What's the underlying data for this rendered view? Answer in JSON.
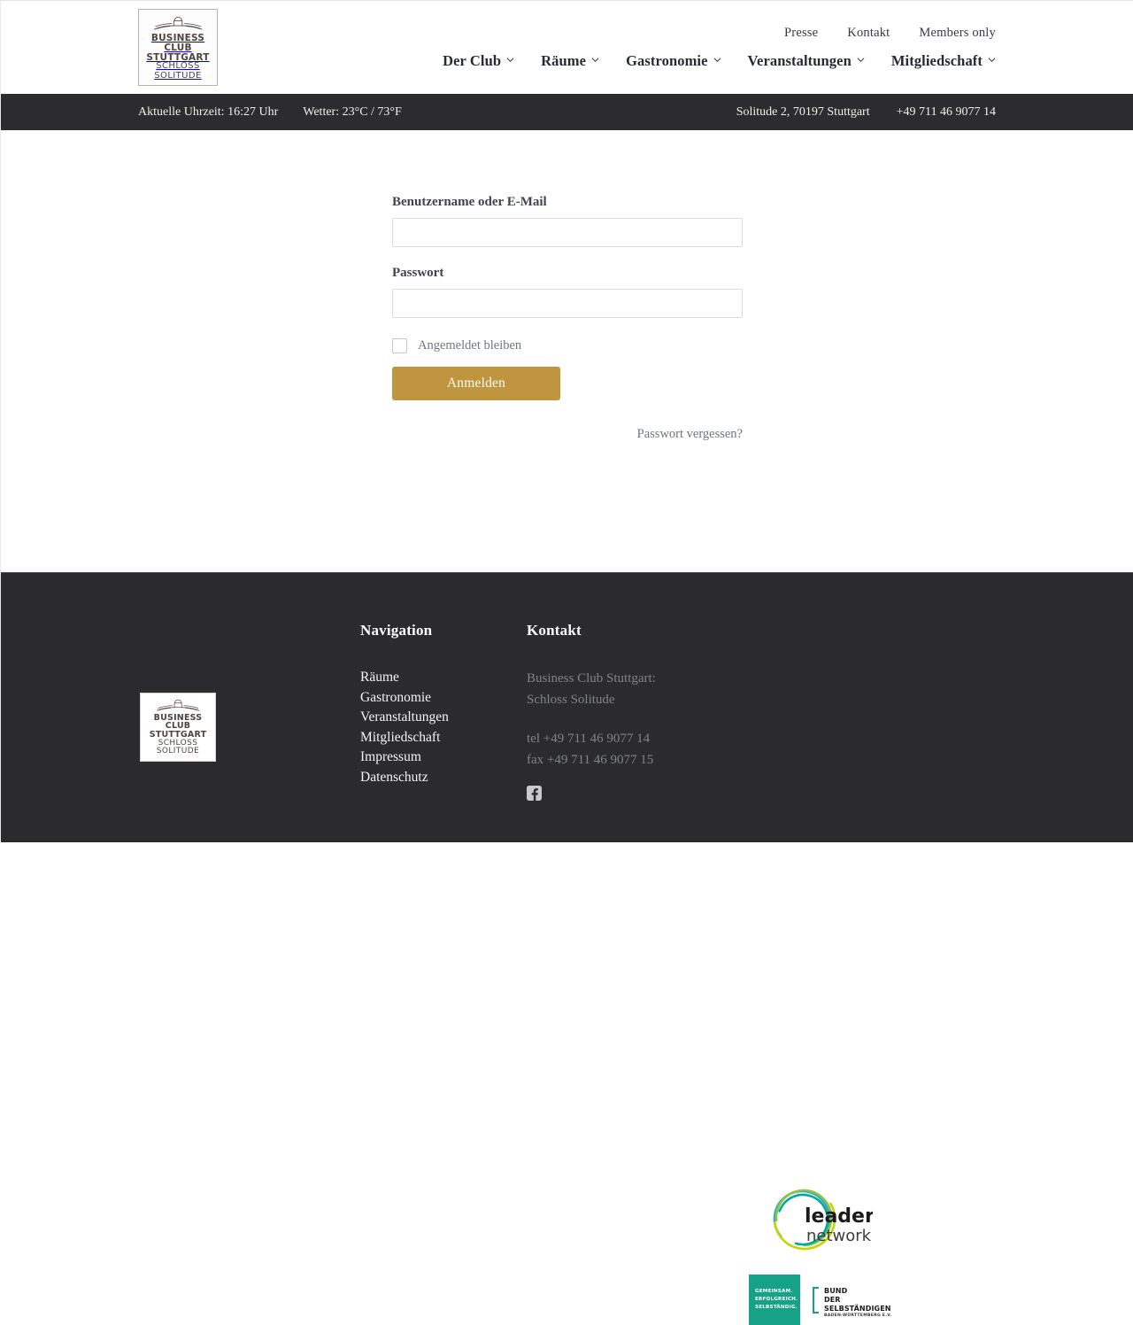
{
  "brand": {
    "logo_lines": [
      "BUSINESS",
      "CLUB",
      "STUTTGART",
      "SCHLOSS",
      "SOLITUDE"
    ],
    "emblem_icon": "palace-emblem-icon"
  },
  "header": {
    "top_links": [
      {
        "label": "Presse"
      },
      {
        "label": "Kontakt"
      },
      {
        "label": "Members only"
      }
    ],
    "nav_items": [
      {
        "label": "Der Club",
        "caret": "chevron-down-icon"
      },
      {
        "label": "Räume",
        "caret": "chevron-down-icon"
      },
      {
        "label": "Gastronomie",
        "caret": "chevron-down-icon"
      },
      {
        "label": "Veranstaltungen",
        "caret": "chevron-down-icon"
      },
      {
        "label": "Mitgliedschaft",
        "caret": "chevron-down-icon"
      }
    ]
  },
  "info_bar": {
    "time": "Aktuelle Uhrzeit: 16:27 Uhr",
    "weather": "Wetter: 23°C / 73°F",
    "address": "Solitude 2, 70197 Stuttgart",
    "phone": "+49 711 46 9077 14",
    "background": "#2c2c2e"
  },
  "login": {
    "username_label": "Benutzername oder E-Mail",
    "username_value": "",
    "username_placeholder": "",
    "password_label": "Passwort",
    "password_value": "",
    "password_placeholder": "",
    "remember_label": "Angemeldet bleiben",
    "remember_checked": false,
    "submit_label": "Anmelden",
    "submit_color": "#bf9540",
    "forgot_label": "Passwort vergessen?"
  },
  "footer": {
    "background": "#2b2b2d",
    "nav_heading": "Navigation",
    "nav_links": [
      {
        "label": "Räume"
      },
      {
        "label": "Gastronomie"
      },
      {
        "label": "Veranstaltungen"
      },
      {
        "label": "Mitgliedschaft"
      },
      {
        "label": "Impressum"
      },
      {
        "label": "Datenschutz"
      }
    ],
    "contact_heading": "Kontakt",
    "contact_name_1": "Business Club Stuttgart:",
    "contact_name_2": "Schloss Solitude",
    "contact_tel": "tel +49 711 46 9077 14",
    "contact_fax": "fax +49 711 46 9077 15",
    "social_icon": "facebook-icon",
    "badges": {
      "leaders": {
        "name": "leaders-network-logo",
        "line1": "leaders",
        "line2": "network"
      },
      "bds": {
        "name": "bund-der-selbstaendigen-logo",
        "slogan_1": "GEMEINSAM.",
        "slogan_2": "ERFOLGREICH.",
        "slogan_3": "SELBSTÄNDIG.",
        "title_1": "BUND",
        "title_2": "DER",
        "title_3": "SELBSTÄNDIGEN",
        "subtitle": "BADEN-WÜRTTEMBERG E.V.",
        "accent": "#16a287"
      }
    }
  }
}
